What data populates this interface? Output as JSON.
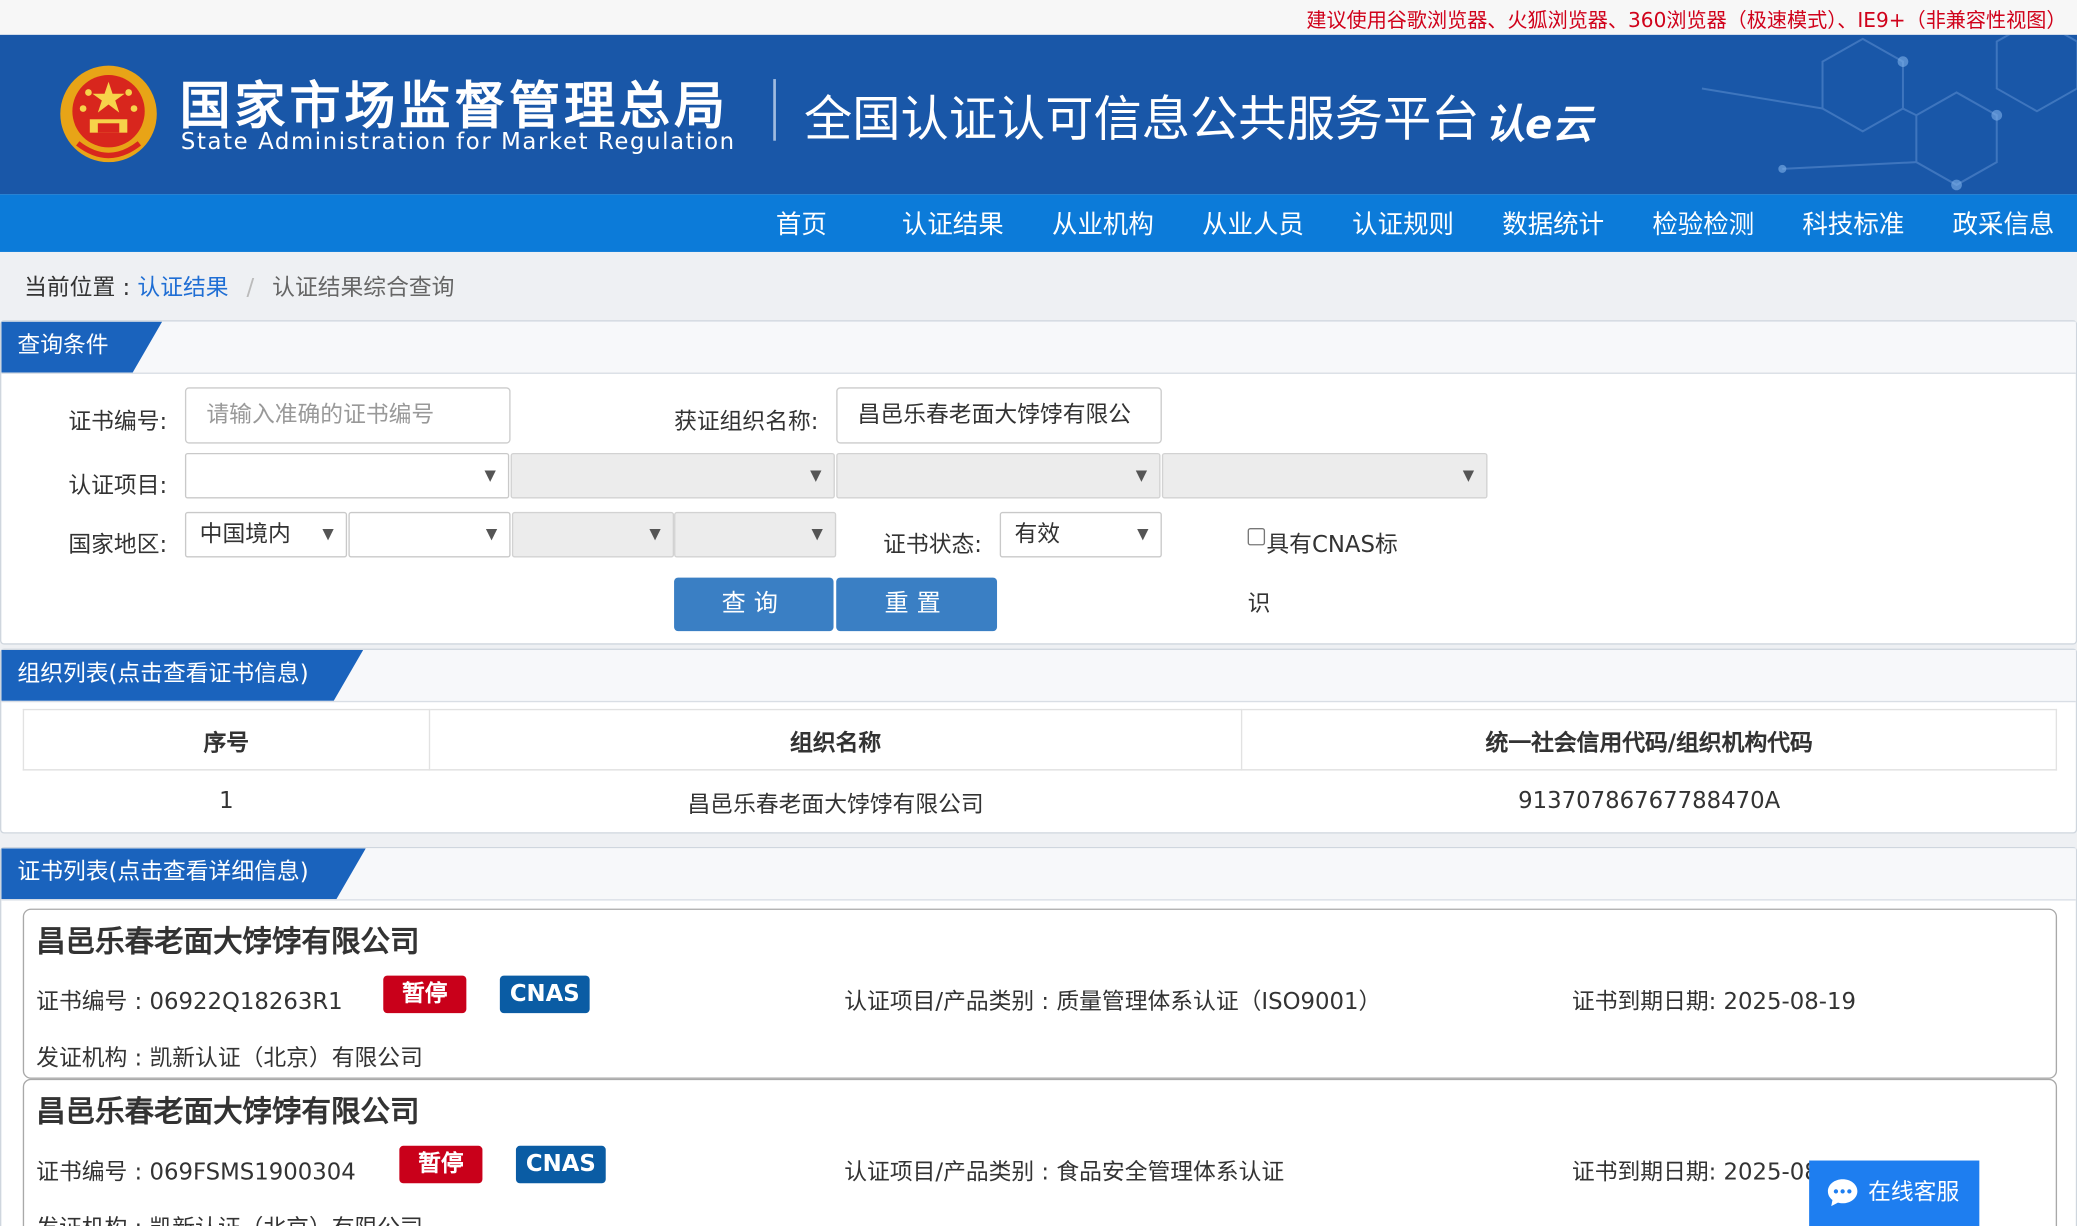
{
  "top_notice": "建议使用谷歌浏览器、火狐浏览器、360浏览器（极速模式）、IE9+（非兼容性视图）",
  "header": {
    "agency_cn": "国家市场监督管理总局",
    "agency_en": "State Administration  for  Market Regulation",
    "platform_title": "全国认证认可信息公共服务平台",
    "cloud_logo": "认e云"
  },
  "nav": [
    "首页",
    "认证结果",
    "从业机构",
    "从业人员",
    "认证规则",
    "数据统计",
    "检验检测",
    "科技标准",
    "政采信息"
  ],
  "breadcrumb": {
    "prefix": "当前位置 :",
    "link": "认证结果",
    "sep": "/",
    "current": "认证结果综合查询"
  },
  "query": {
    "tab": "查询条件",
    "cert_no_label": "证书编号:",
    "cert_no_placeholder": "请输入准确的证书编号",
    "org_label": "获证组织名称:",
    "org_value": "昌邑乐春老面大饽饽有限公",
    "project_label": "认证项目:",
    "region_label": "国家地区:",
    "region_value": "中国境内",
    "status_label": "证书状态:",
    "status_value": "有效",
    "cnas_label_1": "具有CNAS标",
    "cnas_label_2": "识",
    "search_btn": "查询",
    "reset_btn": "重置"
  },
  "org_list": {
    "tab": "组织列表(点击查看证书信息)",
    "columns": [
      "序号",
      "组织名称",
      "统一社会信用代码/组织机构代码"
    ],
    "rows": [
      [
        "1",
        "昌邑乐春老面大饽饽有限公司",
        "91370786767788470A"
      ]
    ]
  },
  "cert_list": {
    "tab": "证书列表(点击查看详细信息)",
    "items": [
      {
        "org": "昌邑乐春老面大饽饽有限公司",
        "cert_no": "证书编号 : 06922Q18263R1",
        "status": "暂停",
        "cnas": "CNAS",
        "project": "认证项目/产品类别 : 质量管理体系认证（ISO9001）",
        "expiry": "证书到期日期: 2025-08-19",
        "issuer": "发证机构 : 凯新认证（北京）有限公司"
      },
      {
        "org": "昌邑乐春老面大饽饽有限公司",
        "cert_no": "证书编号 : 069FSMS1900304",
        "status": "暂停",
        "cnas": "CNAS",
        "project": "认证项目/产品类别 : 食品安全管理体系认证",
        "expiry": "证书到期日期: 2025-08-19",
        "issuer": "发证机构 : 凯新认证（北京）有限公司"
      }
    ]
  },
  "online_service": "在线客服",
  "colors": {
    "brand_blue": "#1957a8",
    "nav_blue": "#0c7bd9",
    "tab_blue": "#1a63bd",
    "notice_red": "#d0021b",
    "badge_red": "#c9001a",
    "badge_blue": "#0a5ca4"
  }
}
